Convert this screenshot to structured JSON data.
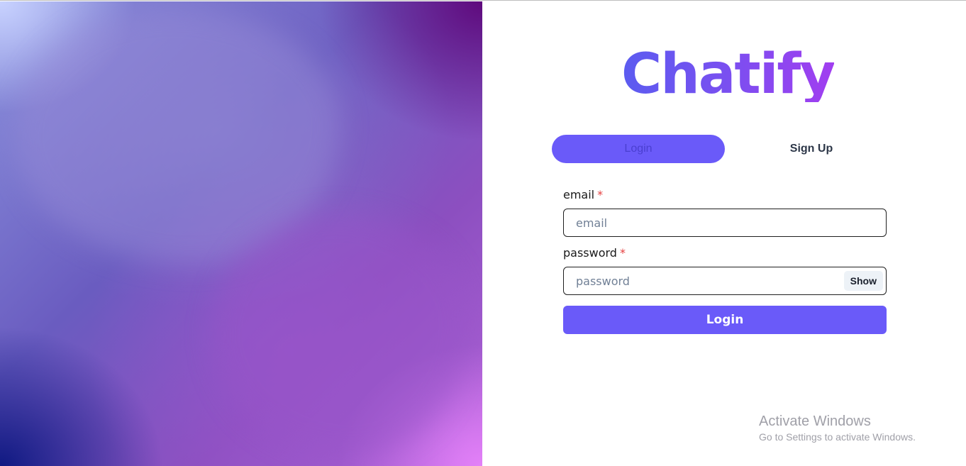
{
  "app": {
    "logo_text": "Chatify"
  },
  "tabs": [
    {
      "label": "Login",
      "active": true
    },
    {
      "label": "Sign Up",
      "active": false
    }
  ],
  "form": {
    "email": {
      "label": "email",
      "required_mark": "*",
      "placeholder": "email",
      "value": ""
    },
    "password": {
      "label": "password",
      "required_mark": "*",
      "placeholder": "password",
      "value": "",
      "toggle_label": "Show"
    },
    "submit_label": "Login"
  },
  "watermark": {
    "title": "Activate Windows",
    "subtitle": "Go to Settings to activate Windows."
  },
  "colors": {
    "accent": "#6a5af9",
    "required": "#e53e3e"
  }
}
